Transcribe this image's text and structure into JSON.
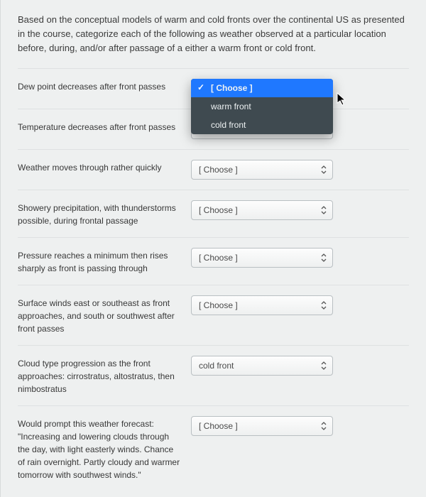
{
  "stem": "Based on the conceptual models of warm and cold fronts over the continental US as presented in the course, categorize each of the following as weather observed at a particular location before, during, and/or after passage of a either a warm front or cold front.",
  "choose_label": "[ Choose ]",
  "options": [
    "[ Choose ]",
    "warm front",
    "cold front"
  ],
  "rows": [
    {
      "prompt": "Dew point decreases after front passes",
      "value": "[ Choose ]",
      "open": true
    },
    {
      "prompt": "Temperature decreases after front passes",
      "value": "[ Choose ]",
      "open": false
    },
    {
      "prompt": "Weather moves through rather quickly",
      "value": "[ Choose ]",
      "open": false
    },
    {
      "prompt": "Showery precipitation, with thunderstorms possible, during frontal passage",
      "value": "[ Choose ]",
      "open": false
    },
    {
      "prompt": "Pressure reaches a minimum then rises sharply as front is passing through",
      "value": "[ Choose ]",
      "open": false
    },
    {
      "prompt": "Surface winds east or southeast as front approaches, and south or southwest after front passes",
      "value": "[ Choose ]",
      "open": false
    },
    {
      "prompt": "Cloud type progression as the front approaches: cirrostratus, altostratus, then nimbostratus",
      "value": "cold front",
      "open": false
    },
    {
      "prompt": "Would prompt this weather forecast: \"Increasing and lowering clouds through the day, with light easterly winds. Chance of rain overnight. Partly cloudy and warmer tomorrow with southwest winds.\"",
      "value": "[ Choose ]",
      "open": false
    }
  ]
}
